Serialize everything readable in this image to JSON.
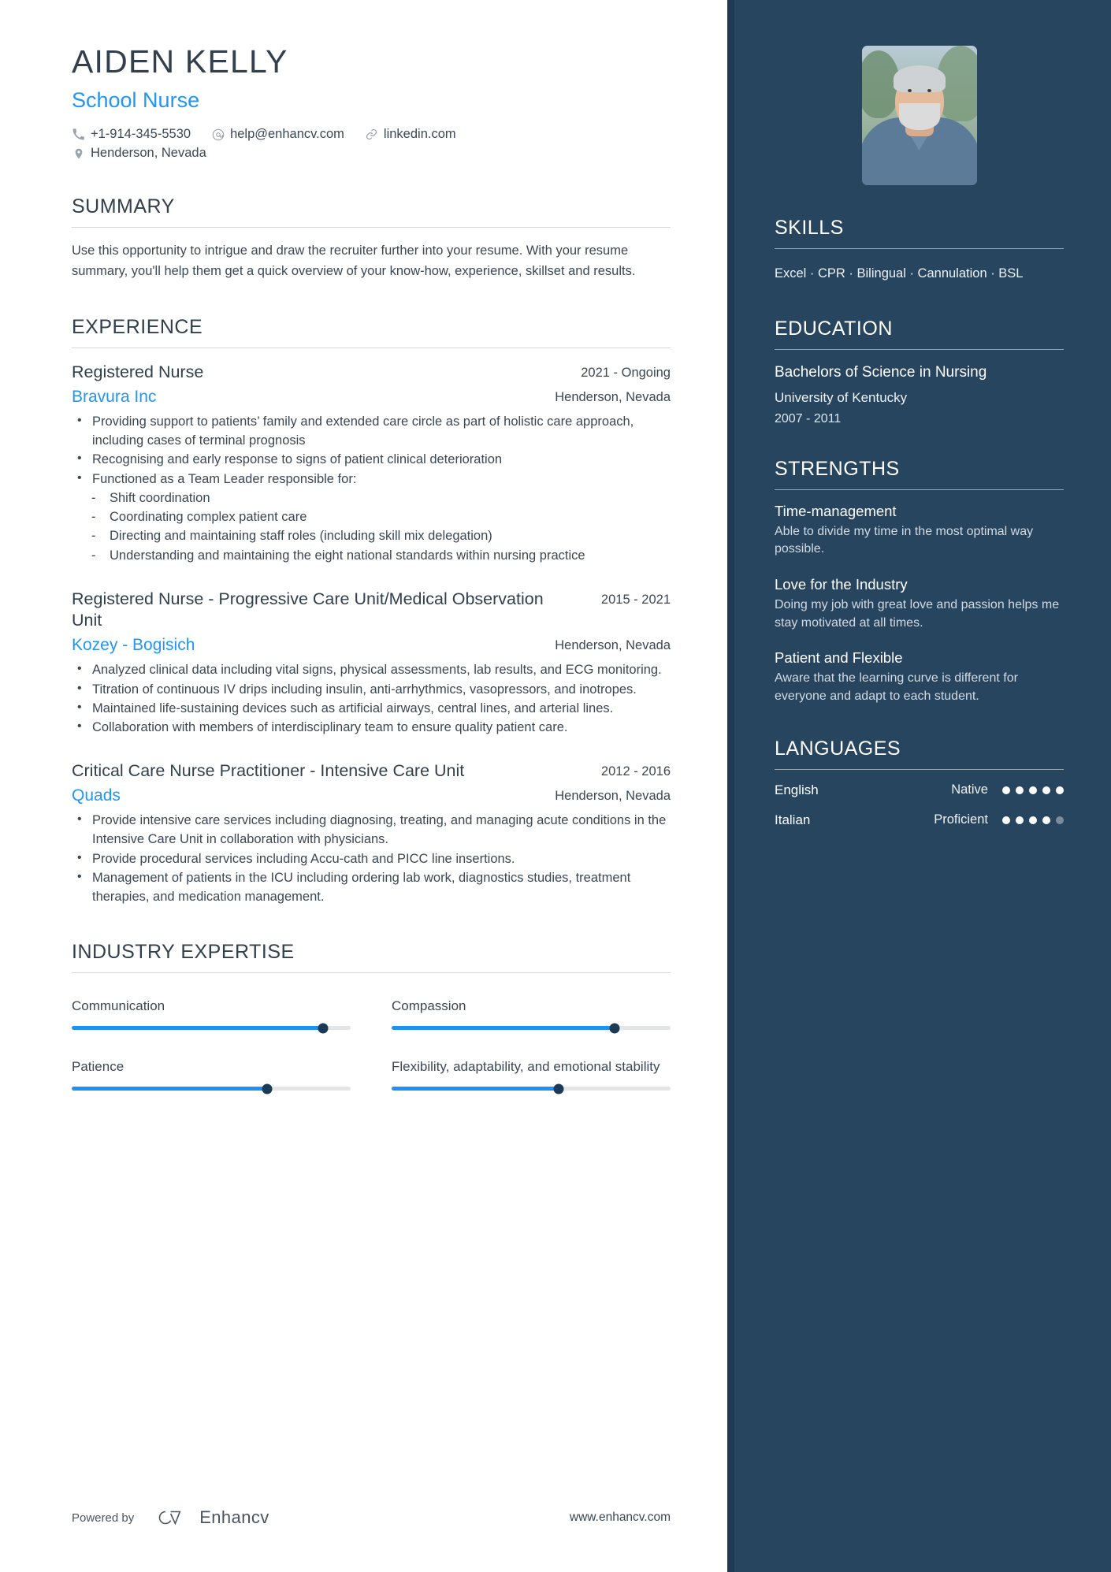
{
  "header": {
    "name": "AIDEN KELLY",
    "role": "School Nurse",
    "contacts": [
      {
        "icon": "phone-icon",
        "text": "+1-914-345-5530"
      },
      {
        "icon": "email-icon",
        "text": "help@enhancv.com"
      },
      {
        "icon": "link-icon",
        "text": "linkedin.com"
      }
    ],
    "location": {
      "icon": "location-pin-icon",
      "text": "Henderson, Nevada"
    }
  },
  "summary": {
    "title": "SUMMARY",
    "text": "Use this opportunity to intrigue and draw the recruiter further into your resume. With your resume summary, you'll help them get a quick overview of your know-how, experience, skillset and results."
  },
  "experience": {
    "title": "EXPERIENCE",
    "jobs": [
      {
        "title": "Registered Nurse",
        "dates": "2021 - Ongoing",
        "company": "Bravura Inc",
        "location": "Henderson, Nevada",
        "bullets": [
          "Providing support to patients’ family and extended care circle as part of holistic care approach, including cases of terminal prognosis",
          "Recognising and early response to signs of patient clinical deterioration",
          "Functioned as a Team Leader responsible for:"
        ],
        "subbullets": [
          "Shift coordination",
          "Coordinating complex patient care",
          "Directing and maintaining staff roles (including skill mix delegation)",
          "Understanding and maintaining the eight national standards within nursing practice"
        ]
      },
      {
        "title": "Registered Nurse - Progressive Care Unit/Medical Observation Unit",
        "dates": "2015 - 2021",
        "company": "Kozey - Bogisich",
        "location": "Henderson, Nevada",
        "bullets": [
          "Analyzed clinical data including vital signs, physical assessments, lab results, and ECG monitoring.",
          "Titration of continuous IV drips including insulin, anti-arrhythmics, vasopressors, and inotropes.",
          "Maintained life-sustaining devices such as artificial airways, central lines, and arterial lines.",
          "Collaboration with members of interdisciplinary team to ensure quality patient care."
        ],
        "subbullets": []
      },
      {
        "title": "Critical Care Nurse Practitioner - Intensive Care Unit",
        "dates": "2012 - 2016",
        "company": "Quads",
        "location": "Henderson, Nevada",
        "bullets": [
          "Provide intensive care services including diagnosing, treating, and managing acute conditions in the Intensive Care Unit in collaboration with physicians.",
          "Provide procedural services including Accu-cath and PICC line insertions.",
          "Management of patients in the ICU including ordering lab work, diagnostics studies, treatment therapies, and medication management."
        ],
        "subbullets": []
      }
    ]
  },
  "industry_expertise": {
    "title": "INDUSTRY EXPERTISE",
    "items": [
      {
        "label": "Communication",
        "value": 90
      },
      {
        "label": "Compassion",
        "value": 80
      },
      {
        "label": "Patience",
        "value": 70
      },
      {
        "label": "Flexibility, adaptability, and emotional stability",
        "value": 60
      }
    ]
  },
  "footer": {
    "powered_by": "Powered by",
    "brand": "Enhancv",
    "website": "www.enhancv.com"
  },
  "sidebar": {
    "skills": {
      "title": "SKILLS",
      "text": "Excel · CPR · Bilingual · Cannulation · BSL"
    },
    "education": {
      "title": "EDUCATION",
      "entries": [
        {
          "degree": "Bachelors of Science in Nursing",
          "school": "University of Kentucky",
          "dates": "2007 - 2011"
        }
      ]
    },
    "strengths": {
      "title": "STRENGTHS",
      "items": [
        {
          "name": "Time-management",
          "description": "Able to divide my time in the most optimal way possible."
        },
        {
          "name": "Love for the Industry",
          "description": "Doing my job with great love and passion helps me stay motivated at all times."
        },
        {
          "name": "Patient and Flexible",
          "description": "Aware that the learning curve is different for everyone and adapt to each student."
        }
      ]
    },
    "languages": {
      "title": "LANGUAGES",
      "items": [
        {
          "name": "English",
          "level": "Native",
          "dots_filled": 5,
          "dots_total": 5
        },
        {
          "name": "Italian",
          "level": "Proficient",
          "dots_filled": 4,
          "dots_total": 5
        }
      ]
    }
  },
  "colors": {
    "accent": "#2196f3",
    "sidebar_bg": "#27455f",
    "sidebar_edge": "#1f3a51",
    "heading": "#32404d",
    "slider_fill": "#1e92f4",
    "slider_knob": "#1b3a57"
  }
}
